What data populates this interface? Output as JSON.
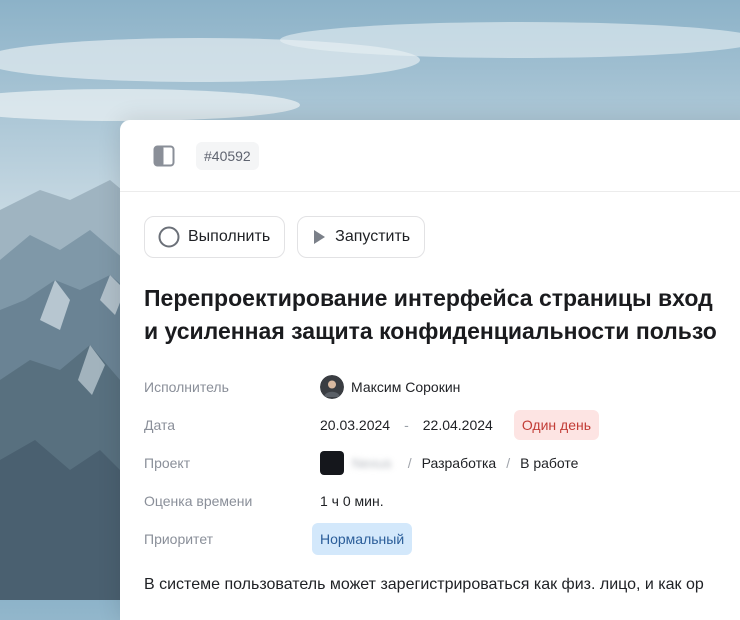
{
  "header": {
    "task_id": "#40592",
    "icons": {
      "toggle": "sidebar-toggle-icon"
    }
  },
  "actions": {
    "complete_label": "Выполнить",
    "start_label": "Запустить",
    "icons": {
      "complete": "circle-icon",
      "start": "play-icon"
    }
  },
  "task": {
    "title_line1": "Перепроектирование интерфейса страницы вход",
    "title_line2": "и усиленная защита конфиденциальности пользо"
  },
  "properties": {
    "assignee": {
      "label": "Исполнитель",
      "name": "Максим Сорокин"
    },
    "date": {
      "label": "Дата",
      "start": "20.03.2024",
      "separator": "-",
      "end": "22.04.2024",
      "duration": "Один день"
    },
    "project": {
      "label": "Проект",
      "name": "Nexus",
      "separator": "/",
      "section": "Разработка",
      "status": "В работе"
    },
    "estimate": {
      "label": "Оценка времени",
      "value": "1 ч 0 мин."
    },
    "priority": {
      "label": "Приоритет",
      "value": "Нормальный"
    }
  },
  "description": "В системе пользователь может зарегистрироваться как физ. лицо, и как ор",
  "colors": {
    "accent_red_bg": "#fde4e3",
    "accent_red_text": "#c23c36",
    "accent_blue_bg": "#d3e8fb",
    "accent_blue_text": "#2a5d99"
  }
}
